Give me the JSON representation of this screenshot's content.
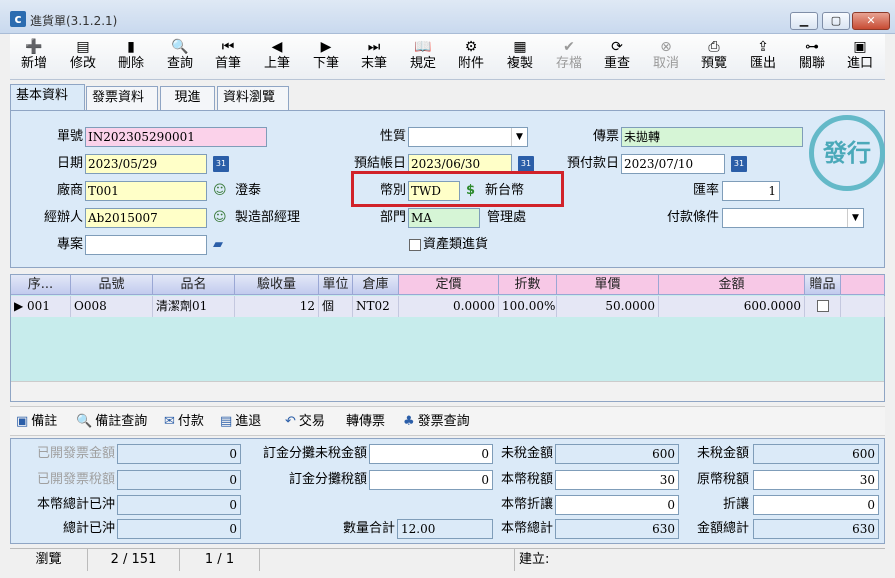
{
  "window": {
    "title": "進貨單(3.1.2.1)",
    "icon_text": "c"
  },
  "toolbar": [
    {
      "id": "new",
      "label": "新增",
      "icon": "add-document-icon",
      "glyph": "➕",
      "enabled": true
    },
    {
      "id": "edit",
      "label": "修改",
      "icon": "edit-icon",
      "glyph": "▤",
      "enabled": true
    },
    {
      "id": "delete",
      "label": "刪除",
      "icon": "trash-icon",
      "glyph": "▮",
      "enabled": true
    },
    {
      "id": "query",
      "label": "查詢",
      "icon": "search-icon",
      "glyph": "🔍",
      "enabled": true
    },
    {
      "id": "first",
      "label": "首筆",
      "icon": "first-record-icon",
      "glyph": "⏮",
      "enabled": true
    },
    {
      "id": "prev",
      "label": "上筆",
      "icon": "previous-record-icon",
      "glyph": "◀",
      "enabled": true
    },
    {
      "id": "next",
      "label": "下筆",
      "icon": "next-record-icon",
      "glyph": "▶",
      "enabled": true
    },
    {
      "id": "last",
      "label": "末筆",
      "icon": "last-record-icon",
      "glyph": "⏭",
      "enabled": true
    },
    {
      "id": "rules",
      "label": "規定",
      "icon": "book-icon",
      "glyph": "📖",
      "enabled": true
    },
    {
      "id": "attach",
      "label": "附件",
      "icon": "attachment-icon",
      "glyph": "⚙",
      "enabled": true
    },
    {
      "id": "copy",
      "label": "複製",
      "icon": "copy-icon",
      "glyph": "▦",
      "enabled": true
    },
    {
      "id": "save",
      "label": "存檔",
      "icon": "save-icon",
      "glyph": "✔",
      "enabled": false
    },
    {
      "id": "recheck",
      "label": "重查",
      "icon": "refresh-icon",
      "glyph": "⟳",
      "enabled": true
    },
    {
      "id": "cancel",
      "label": "取消",
      "icon": "cancel-icon",
      "glyph": "⊗",
      "enabled": false
    },
    {
      "id": "preview",
      "label": "預覽",
      "icon": "print-preview-icon",
      "glyph": "⎙",
      "enabled": true
    },
    {
      "id": "export",
      "label": "匯出",
      "icon": "export-icon",
      "glyph": "⇪",
      "enabled": true
    },
    {
      "id": "link",
      "label": "關聯",
      "icon": "link-tree-icon",
      "glyph": "⊶",
      "enabled": true
    },
    {
      "id": "exit",
      "label": "進口",
      "icon": "exit-icon",
      "glyph": "▣",
      "enabled": true
    }
  ],
  "tabs": [
    "基本資料",
    "發票資料",
    "現進",
    "資料瀏覽"
  ],
  "form": {
    "doc_no_label": "單號",
    "doc_no": "IN202305290001",
    "date_label": "日期",
    "date": "2023/05/29",
    "vendor_label": "廠商",
    "vendor_code": "T001",
    "vendor_name": "澄泰",
    "handler_label": "經辦人",
    "handler_code": "Ab2015007",
    "handler_name": "製造部經理",
    "project_label": "專案",
    "project": "",
    "nature_label": "性質",
    "nature": "",
    "close_date_label": "預結帳日",
    "close_date": "2023/06/30",
    "currency_label": "幣別",
    "currency_code": "TWD",
    "currency_name": "新台幣",
    "dept_label": "部門",
    "dept_code": "MA",
    "dept_name": "管理處",
    "asset_label": "資產類進貨",
    "asset_checked": false,
    "voucher_label": "傳票",
    "voucher": "未拋轉",
    "pay_date_label": "預付款日",
    "pay_date": "2023/07/10",
    "rate_label": "匯率",
    "rate": "1",
    "terms_label": "付款條件",
    "terms": "",
    "stamp": "發行",
    "calendar_icon_text": "31"
  },
  "grid": {
    "columns": [
      "序...",
      "品號",
      "品名",
      "驗收量",
      "單位",
      "倉庫",
      "定價",
      "折數",
      "單價",
      "金額",
      "贈品"
    ],
    "rows": [
      {
        "seq": "001",
        "item_no": "O008",
        "item_name": "清潔劑01",
        "qty": "12",
        "unit": "個",
        "warehouse": "NT02",
        "list_price": "0.0000",
        "discount": "100.00%",
        "unit_price": "50.0000",
        "amount": "600.0000",
        "gift": false
      }
    ]
  },
  "bottom_actions": [
    {
      "label": "備註",
      "icon": "note-icon",
      "glyph": "▣"
    },
    {
      "label": "備註查詢",
      "icon": "search-icon",
      "glyph": "🔍"
    },
    {
      "label": "付款",
      "icon": "payment-icon",
      "glyph": "✉"
    },
    {
      "label": "進退",
      "icon": "return-icon",
      "glyph": "▤"
    },
    {
      "label": "交易",
      "icon": "transaction-icon",
      "glyph": "↶"
    },
    {
      "label": "轉傳票",
      "icon": "",
      "glyph": ""
    },
    {
      "label": "發票查詢",
      "icon": "invoice-query-icon",
      "glyph": "♣"
    }
  ],
  "totals": {
    "invoiced_amount_label": "已開發票金額",
    "invoiced_amount": "0",
    "invoiced_tax_label": "已開發票稅額",
    "invoiced_tax": "0",
    "total_offset_local_label": "本幣總計已沖",
    "total_offset_local": "0",
    "total_offset_label": "總計已沖",
    "total_offset": "0",
    "deposit_untaxed_label": "訂金分攤未稅金額",
    "deposit_untaxed": "0",
    "deposit_tax_label": "訂金分攤稅額",
    "deposit_tax": "0",
    "qty_total_label": "數量合計",
    "qty_total": "12.00",
    "untaxed_local_label": "未稅金額",
    "untaxed_local": "600",
    "tax_local_label": "本幣稅額",
    "tax_local": "30",
    "discount_local_label": "本幣折讓",
    "discount_local": "0",
    "total_local_label": "本幣總計",
    "total_local": "630",
    "untaxed_label": "未稅金額",
    "untaxed": "600",
    "tax_orig_label": "原幣稅額",
    "tax_orig": "30",
    "discount_label": "折讓",
    "discount": "0",
    "grand_total_label": "金額總計",
    "grand_total": "630"
  },
  "status": {
    "mode": "瀏覽",
    "record": "2 / 151",
    "page": "1 / 1",
    "created_label": "建立:"
  }
}
